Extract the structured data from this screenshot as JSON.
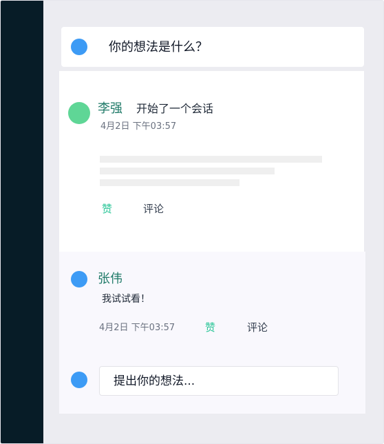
{
  "composer": {
    "prompt": "你的想法是什么？"
  },
  "post": {
    "author": "李强",
    "action": "开始了一个会话",
    "time": "4月2日  下午03:57",
    "like_label": "赞",
    "comment_label": "评论"
  },
  "comment": {
    "author": "张伟",
    "text": "我试试看！",
    "time": "4月2日  下午03:57",
    "like_label": "赞",
    "comment_label": "评论"
  },
  "reply": {
    "placeholder": "提出你的想法..."
  },
  "colors": {
    "sidebar": "#071c27",
    "accent_green": "#2fc79a",
    "author_teal": "#1f7a68",
    "avatar_blue": "#3d9bf5",
    "avatar_green": "#5fd696"
  }
}
